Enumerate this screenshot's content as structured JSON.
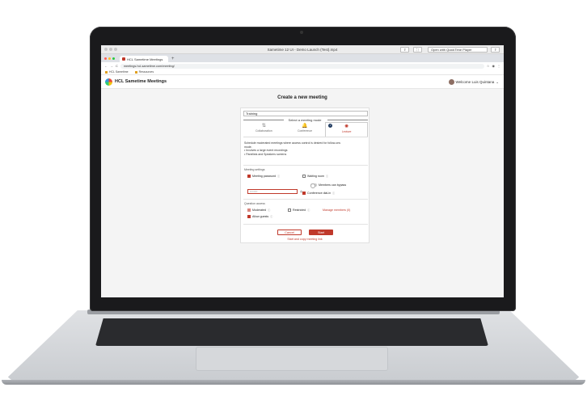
{
  "os": {
    "window_title": "Sametime 12 UI - Demo Launch (Test).mp4",
    "btn_share": "⇪",
    "btn_full": "⛶",
    "btn_open": "Open with QuickTime Player",
    "btn_share2": "⇪"
  },
  "browser": {
    "tab_label": "HCL Sametime Meetings",
    "new_tab": "+",
    "nav_back": "←",
    "nav_fwd": "→",
    "nav_reload": "C",
    "url": "meetings.hcl-sametime.com/meeting/",
    "bookmarks": [
      "HCL Sametime",
      "Ressources"
    ]
  },
  "app": {
    "title": "HCL Sametime Meetings",
    "welcome": "Welcome Luis Quintana",
    "heading": "Create a new meeting",
    "meeting_name": "Training",
    "mode_label": "Select a meeting mode",
    "modes": [
      {
        "label": "Collaboration",
        "icon": "⇅"
      },
      {
        "label": "Conference",
        "icon": "🔔"
      },
      {
        "label": "Lecture",
        "icon": "✺"
      }
    ],
    "selected_check": "✓",
    "description": [
      "Schedule moderated meetings where access control is desired for follow-ons",
      "mode.",
      "• Involves a large event recordings",
      "• Panelists and Speakers screens"
    ],
    "settings_label": "Meeting settings",
    "meeting_password": "Meeting password",
    "password_placeholder": "••••••••",
    "waiting_room": "Waiting room",
    "members_can_bypass": "Members can bypass",
    "conference_dial_in": "Conference dial-in",
    "question_label": "Question access",
    "moderated": "Moderated",
    "restricted": "Restricted",
    "manage_members": "Manage members (0)",
    "allow_guests": "Allow guests",
    "cancel": "Cancel",
    "start": "Start",
    "start_copy": "Start and copy meeting link",
    "info_glyph": "ⓘ"
  },
  "colors": {
    "accent": "#c0392b",
    "check_bg": "#1f3a5f"
  }
}
